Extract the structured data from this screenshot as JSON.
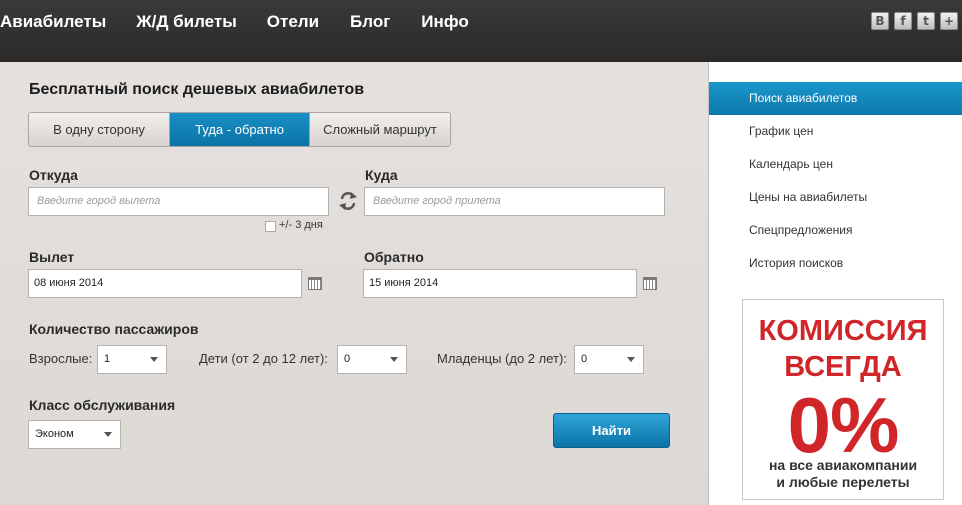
{
  "nav": {
    "items": [
      "Авиабилеты",
      "Ж/Д билеты",
      "Отели",
      "Блог",
      "Инфо"
    ]
  },
  "social": [
    "B",
    "f",
    "t",
    "+"
  ],
  "form": {
    "title": "Бесплатный поиск дешевых авиабилетов",
    "tabs": [
      "В одну сторону",
      "Туда - обратно",
      "Сложный маршрут"
    ],
    "active_tab": "Туда - обратно",
    "from": {
      "label": "Откуда",
      "placeholder": "Введите город вылета"
    },
    "to": {
      "label": "Куда",
      "placeholder": "Введите город прилета"
    },
    "flex_dates": "+/- 3 дня",
    "depart": {
      "label": "Вылет",
      "value": "08 июня 2014"
    },
    "return": {
      "label": "Обратно",
      "value": "15 июня 2014"
    },
    "passengers": {
      "title": "Количество пассажиров",
      "adults": {
        "label": "Взрослые:",
        "value": "1"
      },
      "children": {
        "label": "Дети (от 2 до 12 лет):",
        "value": "0"
      },
      "infants": {
        "label": "Младенцы (до 2 лет):",
        "value": "0"
      }
    },
    "class": {
      "label": "Класс обслуживания",
      "value": "Эконом"
    },
    "search_button": "Найти"
  },
  "sidebar": {
    "items": [
      "Поиск авиабилетов",
      "График цен",
      "Календарь цен",
      "Цены на авиабилеты",
      "Спецпредложения",
      "История поисков"
    ],
    "active": "Поиск авиабилетов"
  },
  "promo": {
    "line1": "КОМИССИЯ",
    "line2": "ВСЕГДА",
    "line3": "0%",
    "line4": "на все авиакомпании",
    "line5": "и любые перелеты"
  },
  "colors": {
    "accent": "#0f7fb4",
    "promo_red": "#d0262a",
    "topbar": "#2f2d2b"
  }
}
